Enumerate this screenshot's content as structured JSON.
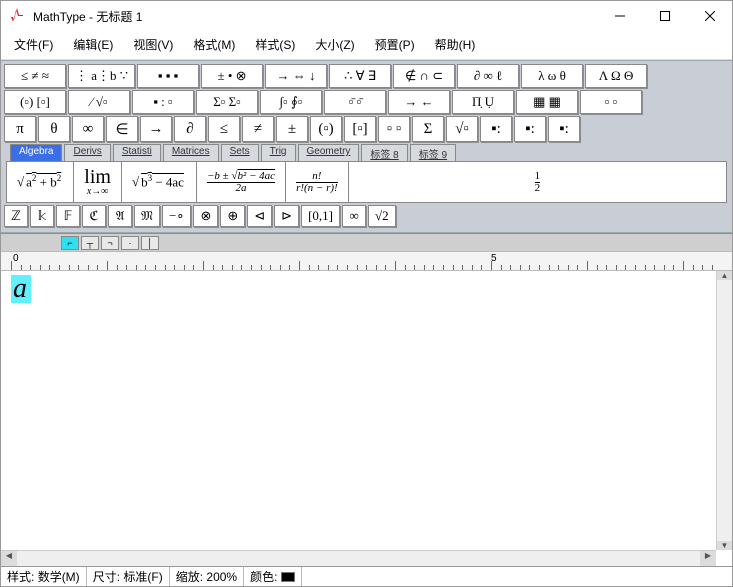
{
  "window": {
    "title": "MathType - 无标题 1"
  },
  "menu": {
    "file": "文件(F)",
    "edit": "编辑(E)",
    "view": "视图(V)",
    "format": "格式(M)",
    "style": "样式(S)",
    "size": "大小(Z)",
    "preset": "预置(P)",
    "help": "帮助(H)"
  },
  "toolbar_row1": {
    "b0": "≤ ≠ ≈",
    "b1": "⋮ a⋮b ∵",
    "b2": "▪ ▪ ▪",
    "b3": "± • ⊗",
    "b4": "→ ⇔ ↓",
    "b5": "∴ ∀ ∃",
    "b6": "∉ ∩ ⊂",
    "b7": "∂ ∞ ℓ",
    "b8": "λ ω θ",
    "b9": "Λ Ω Θ"
  },
  "toolbar_row2": {
    "b0": "(▫) [▫]",
    "b1": "⁄ √▫",
    "b2": "▪ : ▫",
    "b3": "Σ▫ Σ▫",
    "b4": "∫▫ ∮▫",
    "b5": "▫̄ ▫̄",
    "b6": "→ ←",
    "b7": "Π̣ Ụ",
    "b8": "▦ ▦",
    "b9": "▫  ▫"
  },
  "toolbar_row3": {
    "b0": "π",
    "b1": "θ",
    "b2": "∞",
    "b3": "∈",
    "b4": "→",
    "b5": "∂",
    "b6": "≤",
    "b7": "≠",
    "b8": "±",
    "b9": "(▫)",
    "b10": "[▫]",
    "b11": "▫ ▫",
    "b12": "Σ",
    "b13": "√▫",
    "b14": "▪:",
    "b15": "▪:",
    "b16": "▪:"
  },
  "tabs": {
    "t0": "Algebra",
    "t1": "Derivs",
    "t2": "Statisti",
    "t3": "Matrices",
    "t4": "Sets",
    "t5": "Trig",
    "t6": "Geometry",
    "t7": "标签 8",
    "t8": "标签 9"
  },
  "templates": {
    "tpl0": "√(a² + b²)",
    "tpl1_top": "lim",
    "tpl1_bot": "x→∞",
    "tpl2": "√(b³ − 4ac)",
    "tpl3_top": "−b ± √(b² − 4ac)",
    "tpl3_bot": "2a",
    "tpl4_top": "n!",
    "tpl4_bot": "r!(n − r)!",
    "tpl5_top": "1",
    "tpl5_bot": "2"
  },
  "symbols_row": {
    "s0": "ℤ",
    "s1": "𝕜",
    "s2": "𝔽",
    "s3": "ℭ",
    "s4": "𝔄",
    "s5": "𝔐",
    "s6": "−∘",
    "s7": "⊗",
    "s8": "⊕",
    "s9": "⊲",
    "s10": "⊳",
    "s11": "[0,1]",
    "s12": "∞",
    "s13": "√2"
  },
  "ruler": {
    "lab0": "0",
    "lab5": "5"
  },
  "editor": {
    "content": "a"
  },
  "status": {
    "style_k": "样式:",
    "style_v": "数学(M)",
    "size_k": "尺寸:",
    "size_v": "标准(F)",
    "zoom_k": "缩放:",
    "zoom_v": "200%",
    "color_k": "颜色:"
  }
}
